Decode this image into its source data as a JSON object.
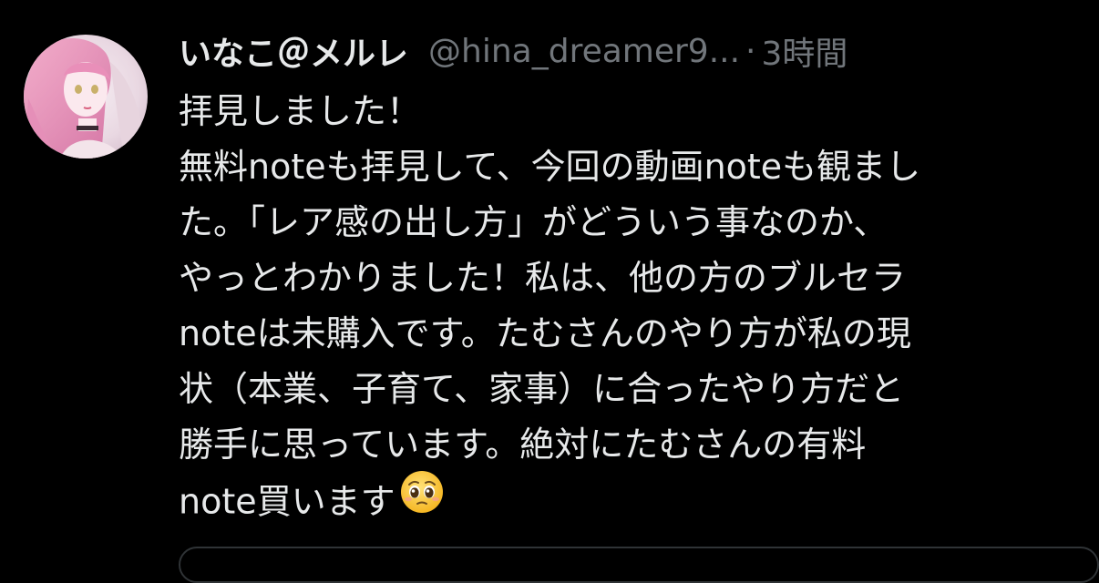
{
  "tweet": {
    "display_name": "いなこ＠メルレ",
    "handle": "@hina_dreamer9...",
    "separator": "·",
    "timestamp": "3時間",
    "lines": [
      "拝見しました！",
      "無料noteも拝見して、今回の動画noteも観まし",
      "た。「レア感の出し方」がどういう事なのか、",
      "やっとわかりました！私は、他の方のブルセラ",
      "noteは未購入です。たむさんのやり方が私の現",
      "状（本業、子育て、家事）に合ったやり方だと",
      "勝手に思っています。絶対にたむさんの有料",
      "note買います"
    ],
    "emoji": "pleading-face-emoji"
  },
  "colors": {
    "background": "#000000",
    "text_primary": "#e7e9ea",
    "text_secondary": "#71767b",
    "border": "#2f3336"
  }
}
